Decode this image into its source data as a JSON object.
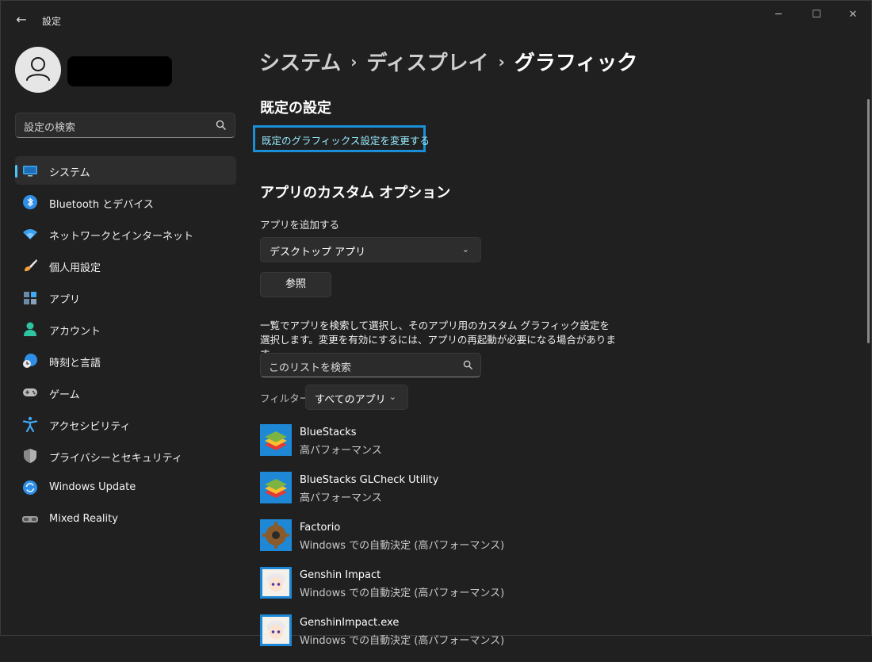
{
  "window": {
    "title": "設定",
    "minimize_glyph": "─",
    "maximize_glyph": "☐",
    "close_glyph": "✕",
    "back_glyph": "←"
  },
  "search": {
    "placeholder": "設定の検索"
  },
  "nav": [
    {
      "label": "システム",
      "icon": "system-display-icon",
      "active": true
    },
    {
      "label": "Bluetooth とデバイス",
      "icon": "bluetooth-icon"
    },
    {
      "label": "ネットワークとインターネット",
      "icon": "wifi-icon"
    },
    {
      "label": "個人用設定",
      "icon": "brush-icon"
    },
    {
      "label": "アプリ",
      "icon": "apps-icon"
    },
    {
      "label": "アカウント",
      "icon": "account-icon"
    },
    {
      "label": "時刻と言語",
      "icon": "globe-clock-icon"
    },
    {
      "label": "ゲーム",
      "icon": "gamepad-icon"
    },
    {
      "label": "アクセシビリティ",
      "icon": "accessibility-icon"
    },
    {
      "label": "プライバシーとセキュリティ",
      "icon": "shield-icon"
    },
    {
      "label": "Windows Update",
      "icon": "update-icon"
    },
    {
      "label": "Mixed Reality",
      "icon": "headset-icon"
    }
  ],
  "breadcrumb": {
    "part1": "システム",
    "part2": "ディスプレイ",
    "current": "グラフィック",
    "separator": "›"
  },
  "defaults": {
    "heading": "既定の設定",
    "link": "既定のグラフィックス設定を変更する"
  },
  "custom": {
    "heading": "アプリのカスタム オプション",
    "add_label": "アプリを追加する",
    "app_type": "デスクトップ アプリ",
    "browse": "参照",
    "description": "一覧でアプリを検索して選択し、そのアプリ用のカスタム グラフィック設定を選択します。変更を有効にするには、アプリの再起動が必要になる場合があります。",
    "list_search_placeholder": "このリストを検索",
    "filter_label": "フィルター:",
    "filter_value": "すべてのアプリ"
  },
  "apps": [
    {
      "name": "BlueStacks",
      "pref": "高パフォーマンス",
      "icon": "bluestacks-icon"
    },
    {
      "name": "BlueStacks GLCheck Utility",
      "pref": "高パフォーマンス",
      "icon": "bluestacks-icon"
    },
    {
      "name": "Factorio",
      "pref": "Windows での自動決定 (高パフォーマンス)",
      "icon": "factorio-gear-icon"
    },
    {
      "name": "Genshin Impact",
      "pref": "Windows での自動決定 (高パフォーマンス)",
      "icon": "genshin-icon"
    },
    {
      "name": "GenshinImpact.exe",
      "pref": "Windows での自動決定 (高パフォーマンス)",
      "icon": "genshin-icon"
    }
  ],
  "colors": {
    "accent": "#4cc2ff",
    "link": "#99ebff",
    "highlight_border": "#1a8fd8",
    "background": "#202020"
  }
}
